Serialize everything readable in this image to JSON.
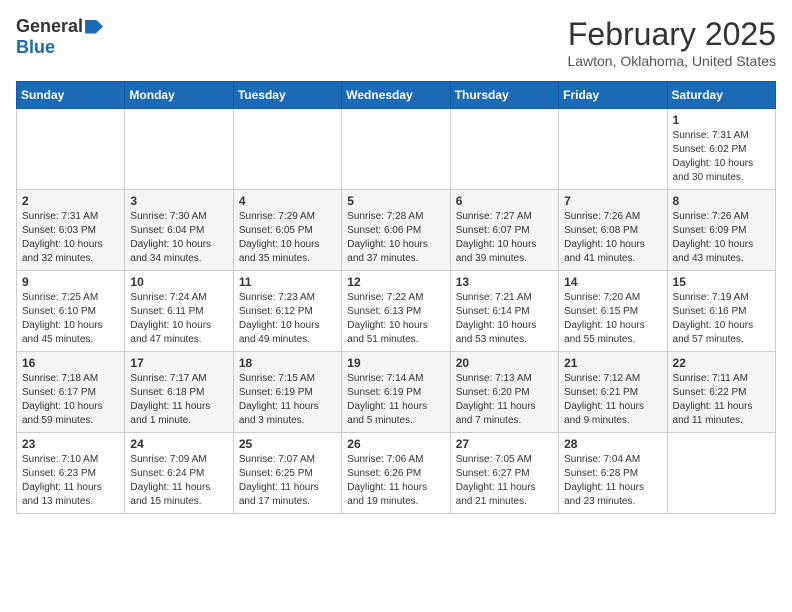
{
  "header": {
    "logo_general": "General",
    "logo_blue": "Blue",
    "month": "February 2025",
    "location": "Lawton, Oklahoma, United States"
  },
  "weekdays": [
    "Sunday",
    "Monday",
    "Tuesday",
    "Wednesday",
    "Thursday",
    "Friday",
    "Saturday"
  ],
  "weeks": [
    [
      {
        "day": "",
        "info": ""
      },
      {
        "day": "",
        "info": ""
      },
      {
        "day": "",
        "info": ""
      },
      {
        "day": "",
        "info": ""
      },
      {
        "day": "",
        "info": ""
      },
      {
        "day": "",
        "info": ""
      },
      {
        "day": "1",
        "info": "Sunrise: 7:31 AM\nSunset: 6:02 PM\nDaylight: 10 hours and 30 minutes."
      }
    ],
    [
      {
        "day": "2",
        "info": "Sunrise: 7:31 AM\nSunset: 6:03 PM\nDaylight: 10 hours and 32 minutes."
      },
      {
        "day": "3",
        "info": "Sunrise: 7:30 AM\nSunset: 6:04 PM\nDaylight: 10 hours and 34 minutes."
      },
      {
        "day": "4",
        "info": "Sunrise: 7:29 AM\nSunset: 6:05 PM\nDaylight: 10 hours and 35 minutes."
      },
      {
        "day": "5",
        "info": "Sunrise: 7:28 AM\nSunset: 6:06 PM\nDaylight: 10 hours and 37 minutes."
      },
      {
        "day": "6",
        "info": "Sunrise: 7:27 AM\nSunset: 6:07 PM\nDaylight: 10 hours and 39 minutes."
      },
      {
        "day": "7",
        "info": "Sunrise: 7:26 AM\nSunset: 6:08 PM\nDaylight: 10 hours and 41 minutes."
      },
      {
        "day": "8",
        "info": "Sunrise: 7:26 AM\nSunset: 6:09 PM\nDaylight: 10 hours and 43 minutes."
      }
    ],
    [
      {
        "day": "9",
        "info": "Sunrise: 7:25 AM\nSunset: 6:10 PM\nDaylight: 10 hours and 45 minutes."
      },
      {
        "day": "10",
        "info": "Sunrise: 7:24 AM\nSunset: 6:11 PM\nDaylight: 10 hours and 47 minutes."
      },
      {
        "day": "11",
        "info": "Sunrise: 7:23 AM\nSunset: 6:12 PM\nDaylight: 10 hours and 49 minutes."
      },
      {
        "day": "12",
        "info": "Sunrise: 7:22 AM\nSunset: 6:13 PM\nDaylight: 10 hours and 51 minutes."
      },
      {
        "day": "13",
        "info": "Sunrise: 7:21 AM\nSunset: 6:14 PM\nDaylight: 10 hours and 53 minutes."
      },
      {
        "day": "14",
        "info": "Sunrise: 7:20 AM\nSunset: 6:15 PM\nDaylight: 10 hours and 55 minutes."
      },
      {
        "day": "15",
        "info": "Sunrise: 7:19 AM\nSunset: 6:16 PM\nDaylight: 10 hours and 57 minutes."
      }
    ],
    [
      {
        "day": "16",
        "info": "Sunrise: 7:18 AM\nSunset: 6:17 PM\nDaylight: 10 hours and 59 minutes."
      },
      {
        "day": "17",
        "info": "Sunrise: 7:17 AM\nSunset: 6:18 PM\nDaylight: 11 hours and 1 minute."
      },
      {
        "day": "18",
        "info": "Sunrise: 7:15 AM\nSunset: 6:19 PM\nDaylight: 11 hours and 3 minutes."
      },
      {
        "day": "19",
        "info": "Sunrise: 7:14 AM\nSunset: 6:19 PM\nDaylight: 11 hours and 5 minutes."
      },
      {
        "day": "20",
        "info": "Sunrise: 7:13 AM\nSunset: 6:20 PM\nDaylight: 11 hours and 7 minutes."
      },
      {
        "day": "21",
        "info": "Sunrise: 7:12 AM\nSunset: 6:21 PM\nDaylight: 11 hours and 9 minutes."
      },
      {
        "day": "22",
        "info": "Sunrise: 7:11 AM\nSunset: 6:22 PM\nDaylight: 11 hours and 11 minutes."
      }
    ],
    [
      {
        "day": "23",
        "info": "Sunrise: 7:10 AM\nSunset: 6:23 PM\nDaylight: 11 hours and 13 minutes."
      },
      {
        "day": "24",
        "info": "Sunrise: 7:09 AM\nSunset: 6:24 PM\nDaylight: 11 hours and 15 minutes."
      },
      {
        "day": "25",
        "info": "Sunrise: 7:07 AM\nSunset: 6:25 PM\nDaylight: 11 hours and 17 minutes."
      },
      {
        "day": "26",
        "info": "Sunrise: 7:06 AM\nSunset: 6:26 PM\nDaylight: 11 hours and 19 minutes."
      },
      {
        "day": "27",
        "info": "Sunrise: 7:05 AM\nSunset: 6:27 PM\nDaylight: 11 hours and 21 minutes."
      },
      {
        "day": "28",
        "info": "Sunrise: 7:04 AM\nSunset: 6:28 PM\nDaylight: 11 hours and 23 minutes."
      },
      {
        "day": "",
        "info": ""
      }
    ]
  ]
}
